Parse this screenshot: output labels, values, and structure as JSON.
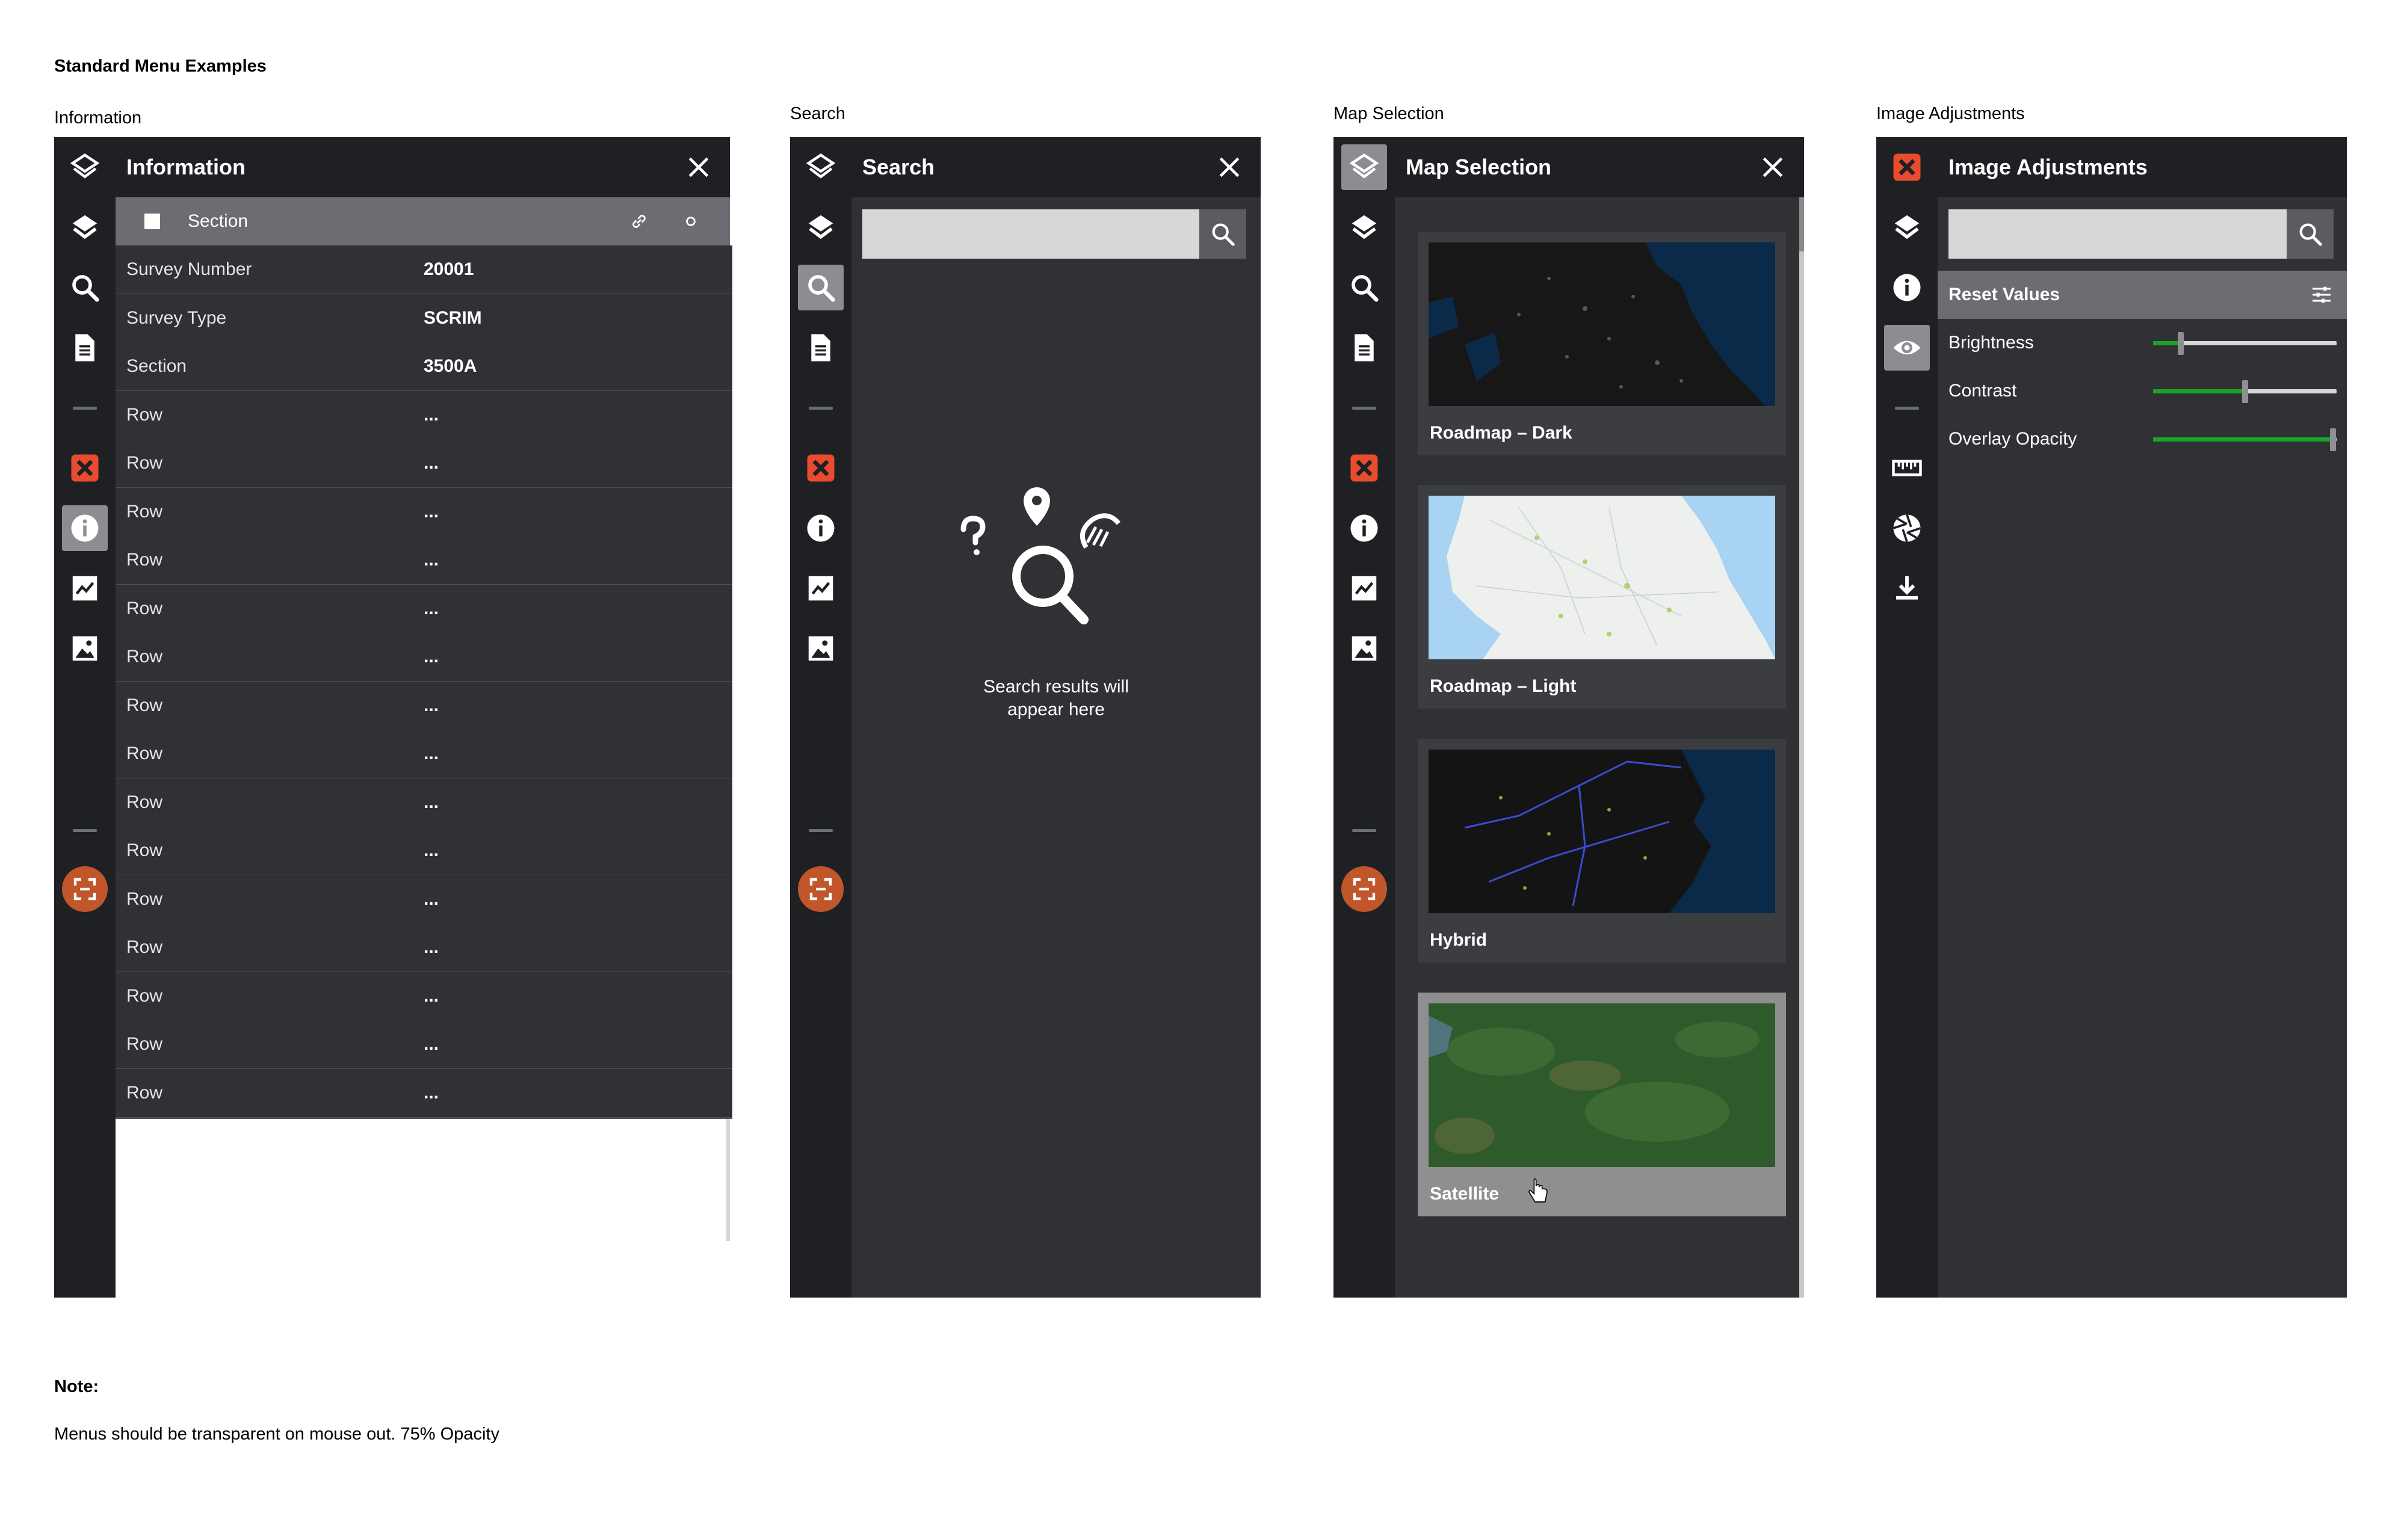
{
  "page": {
    "title": "Standard Menu Examples",
    "note_heading": "Note:",
    "note_text": "Menus should be transparent on mouse out. 75% Opacity"
  },
  "information": {
    "caption": "Information",
    "title": "Information",
    "section_label": "Section",
    "rows": [
      {
        "key": "Survey Number",
        "value": "20001"
      },
      {
        "key": "Survey Type",
        "value": "SCRIM"
      },
      {
        "key": "Section",
        "value": "3500A"
      },
      {
        "key": "Row",
        "value": "..."
      },
      {
        "key": "Row",
        "value": "..."
      },
      {
        "key": "Row",
        "value": "..."
      },
      {
        "key": "Row",
        "value": "..."
      },
      {
        "key": "Row",
        "value": "..."
      },
      {
        "key": "Row",
        "value": "..."
      },
      {
        "key": "Row",
        "value": "..."
      },
      {
        "key": "Row",
        "value": "..."
      },
      {
        "key": "Row",
        "value": "..."
      },
      {
        "key": "Row",
        "value": "..."
      },
      {
        "key": "Row",
        "value": "..."
      },
      {
        "key": "Row",
        "value": "..."
      },
      {
        "key": "Row",
        "value": "..."
      },
      {
        "key": "Row",
        "value": "..."
      },
      {
        "key": "Row",
        "value": "..."
      }
    ]
  },
  "search": {
    "caption": "Search",
    "title": "Search",
    "input_value": "",
    "empty_text_line1": "Search results will",
    "empty_text_line2": "appear here"
  },
  "map_selection": {
    "caption": "Map Selection",
    "title": "Map Selection",
    "cards": [
      {
        "label": "Roadmap – Dark",
        "selected": false
      },
      {
        "label": "Roadmap – Light",
        "selected": false
      },
      {
        "label": "Hybrid",
        "selected": false
      },
      {
        "label": "Satellite",
        "selected": true
      }
    ]
  },
  "image_adjustments": {
    "caption": "Image Adjustments",
    "title": "Image Adjustments",
    "input_value": "",
    "reset_label": "Reset Values",
    "sliders": [
      {
        "label": "Brightness",
        "fraction": 0.15
      },
      {
        "label": "Contrast",
        "fraction": 0.5
      },
      {
        "label": "Overlay Opacity",
        "fraction": 0.98
      }
    ]
  },
  "colors": {
    "panel_bg": "#2f3135",
    "rail_bg": "#1e2024",
    "accent_red": "#e94b2f",
    "accent_orange": "#c0562a",
    "slider_green": "#1aa32a"
  }
}
